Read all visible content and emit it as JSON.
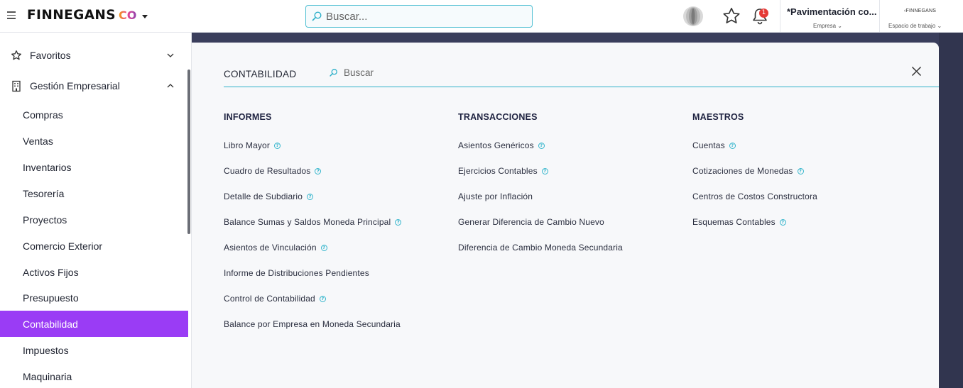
{
  "header": {
    "brand_name": "FINNEGANS",
    "brand_suffix": "CO",
    "search_placeholder": "Buscar...",
    "notifications_count": "1",
    "company_name": "*Pavimentación co...",
    "company_label": "Empresa",
    "workspace_logo": "FINNEGANS",
    "workspace_label": "Espacio de trabajo"
  },
  "sidebar": {
    "favorites_label": "Favoritos",
    "group_label": "Gestión Empresarial",
    "items": [
      {
        "label": "Compras"
      },
      {
        "label": "Ventas"
      },
      {
        "label": "Inventarios"
      },
      {
        "label": "Tesorería"
      },
      {
        "label": "Proyectos"
      },
      {
        "label": "Comercio Exterior"
      },
      {
        "label": "Activos Fijos"
      },
      {
        "label": "Presupuesto"
      },
      {
        "label": "Contabilidad",
        "active": true
      },
      {
        "label": "Impuestos"
      },
      {
        "label": "Maquinaria"
      }
    ]
  },
  "panel": {
    "title": "CONTABILIDAD",
    "search_placeholder": "Buscar",
    "columns": [
      {
        "heading": "INFORMES",
        "links": [
          {
            "label": "Libro Mayor",
            "help": true
          },
          {
            "label": "Cuadro de Resultados",
            "help": true
          },
          {
            "label": "Detalle de Subdiario",
            "help": true
          },
          {
            "label": "Balance Sumas y Saldos Moneda Principal",
            "help": true
          },
          {
            "label": "Asientos de Vinculación",
            "help": true
          },
          {
            "label": "Informe de Distribuciones Pendientes",
            "help": false
          },
          {
            "label": "Control de Contabilidad",
            "help": true
          },
          {
            "label": "Balance por Empresa en Moneda Secundaria",
            "help": false
          }
        ]
      },
      {
        "heading": "TRANSACCIONES",
        "links": [
          {
            "label": "Asientos Genéricos",
            "help": true
          },
          {
            "label": "Ejercicios Contables",
            "help": true
          },
          {
            "label": "Ajuste por Inflación",
            "help": false
          },
          {
            "label": "Generar Diferencia de Cambio Nuevo",
            "help": false
          },
          {
            "label": "Diferencia de Cambio Moneda Secundaria",
            "help": false
          }
        ]
      },
      {
        "heading": "MAESTROS",
        "links": [
          {
            "label": "Cuentas",
            "help": true
          },
          {
            "label": "Cotizaciones de Monedas",
            "help": true
          },
          {
            "label": "Centros de Costos Constructora",
            "help": false
          },
          {
            "label": "Esquemas Contables",
            "help": true
          }
        ]
      }
    ]
  },
  "colors": {
    "accent": "#9a3cf5",
    "teal": "#2eb0c9",
    "background_dark": "#3a3e5c"
  }
}
